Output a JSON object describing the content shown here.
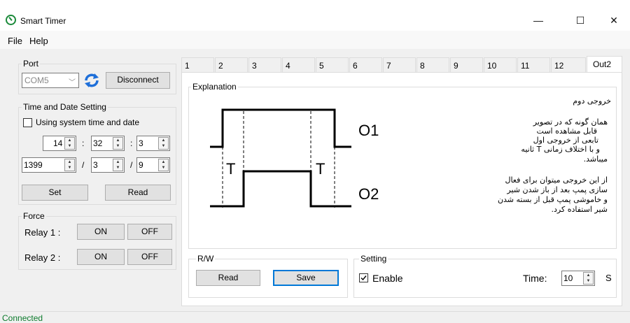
{
  "window": {
    "title": "Smart Timer",
    "min": "—",
    "max": "☐",
    "close": "✕"
  },
  "menu": {
    "file": "File",
    "help": "Help"
  },
  "port": {
    "label": "Port",
    "combo_value": "COM5",
    "disconnect": "Disconnect"
  },
  "time_date": {
    "label": "Time and Date Setting",
    "use_system": "Using system time and date",
    "hour": "14",
    "minute": "32",
    "second": "3",
    "year": "1399",
    "month": "3",
    "day": "9",
    "sep_colon": ":",
    "sep_slash": "/",
    "set": "Set",
    "read": "Read"
  },
  "force": {
    "label": "Force",
    "relay1": "Relay 1 :",
    "relay2": "Relay 2 :",
    "on": "ON",
    "off": "OFF"
  },
  "tabs": [
    "1",
    "2",
    "3",
    "4",
    "5",
    "6",
    "7",
    "8",
    "9",
    "10",
    "11",
    "12",
    "Out2"
  ],
  "explanation": {
    "label": "Explanation",
    "diagram": {
      "o1": "O1",
      "o2": "O2",
      "t": "T"
    },
    "lines": [
      "خروجی دوم",
      "",
      "همان گونه که در تصویر",
      "قابل مشاهده است",
      "تابعی از خروجی اول",
      "و با اختلاف زمانی T ثانیه",
      "میباشد.",
      "",
      "از این خروجی میتوان برای فعال",
      "سازی پمپ بعد از باز شدن شیر",
      "و خاموشی پمپ قبل از بسته شدن",
      "شیر استفاده کرد."
    ]
  },
  "rw": {
    "label": "R/W",
    "read": "Read",
    "save": "Save"
  },
  "setting": {
    "label": "Setting",
    "enable": "Enable",
    "enable_checked": true,
    "time_label": "Time:",
    "time_value": "10",
    "unit": "S"
  },
  "status": {
    "text": "Connected"
  }
}
